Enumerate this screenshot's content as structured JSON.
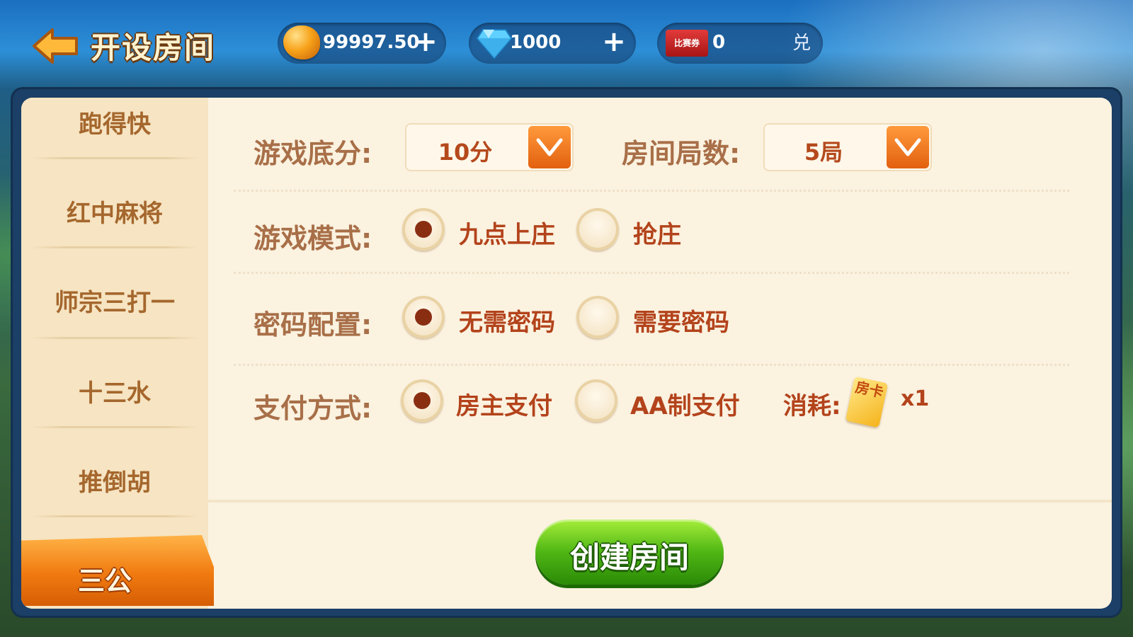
{
  "header": {
    "title": "开设房间",
    "back_icon": "back-arrow-icon",
    "coins": {
      "value": "99997.50",
      "icon": "coin-icon",
      "add_icon": "plus-icon"
    },
    "diamonds": {
      "value": "1000",
      "icon": "diamond-icon",
      "add_icon": "plus-icon"
    },
    "tickets": {
      "icon_label": "比赛券",
      "value": "0",
      "exchange_label": "兑"
    }
  },
  "sidebar": {
    "items": [
      {
        "label": "跑得快"
      },
      {
        "label": "红中麻将"
      },
      {
        "label": "师宗三打一"
      },
      {
        "label": "十三水"
      },
      {
        "label": "推倒胡"
      }
    ],
    "active": {
      "label": "三公"
    }
  },
  "form": {
    "base_score": {
      "label": "游戏底分:",
      "value": "10分"
    },
    "rounds": {
      "label": "房间局数:",
      "value": "5局"
    },
    "mode": {
      "label": "游戏模式:",
      "options": [
        {
          "label": "九点上庄",
          "selected": true
        },
        {
          "label": "抢庄",
          "selected": false
        }
      ]
    },
    "password": {
      "label": "密码配置:",
      "options": [
        {
          "label": "无需密码",
          "selected": true
        },
        {
          "label": "需要密码",
          "selected": false
        }
      ]
    },
    "payment": {
      "label": "支付方式:",
      "options": [
        {
          "label": "房主支付",
          "selected": true
        },
        {
          "label": "AA制支付",
          "selected": false
        }
      ],
      "cost_label": "消耗:",
      "card_icon_text": "房卡",
      "cost_value": "x1"
    }
  },
  "actions": {
    "create_label": "创建房间"
  },
  "colors": {
    "accent_orange": "#f07a10",
    "label_brown": "#a86f48",
    "value_red": "#b3431b",
    "button_green": "#4fb614",
    "panel_bg": "#fbf2e0"
  }
}
